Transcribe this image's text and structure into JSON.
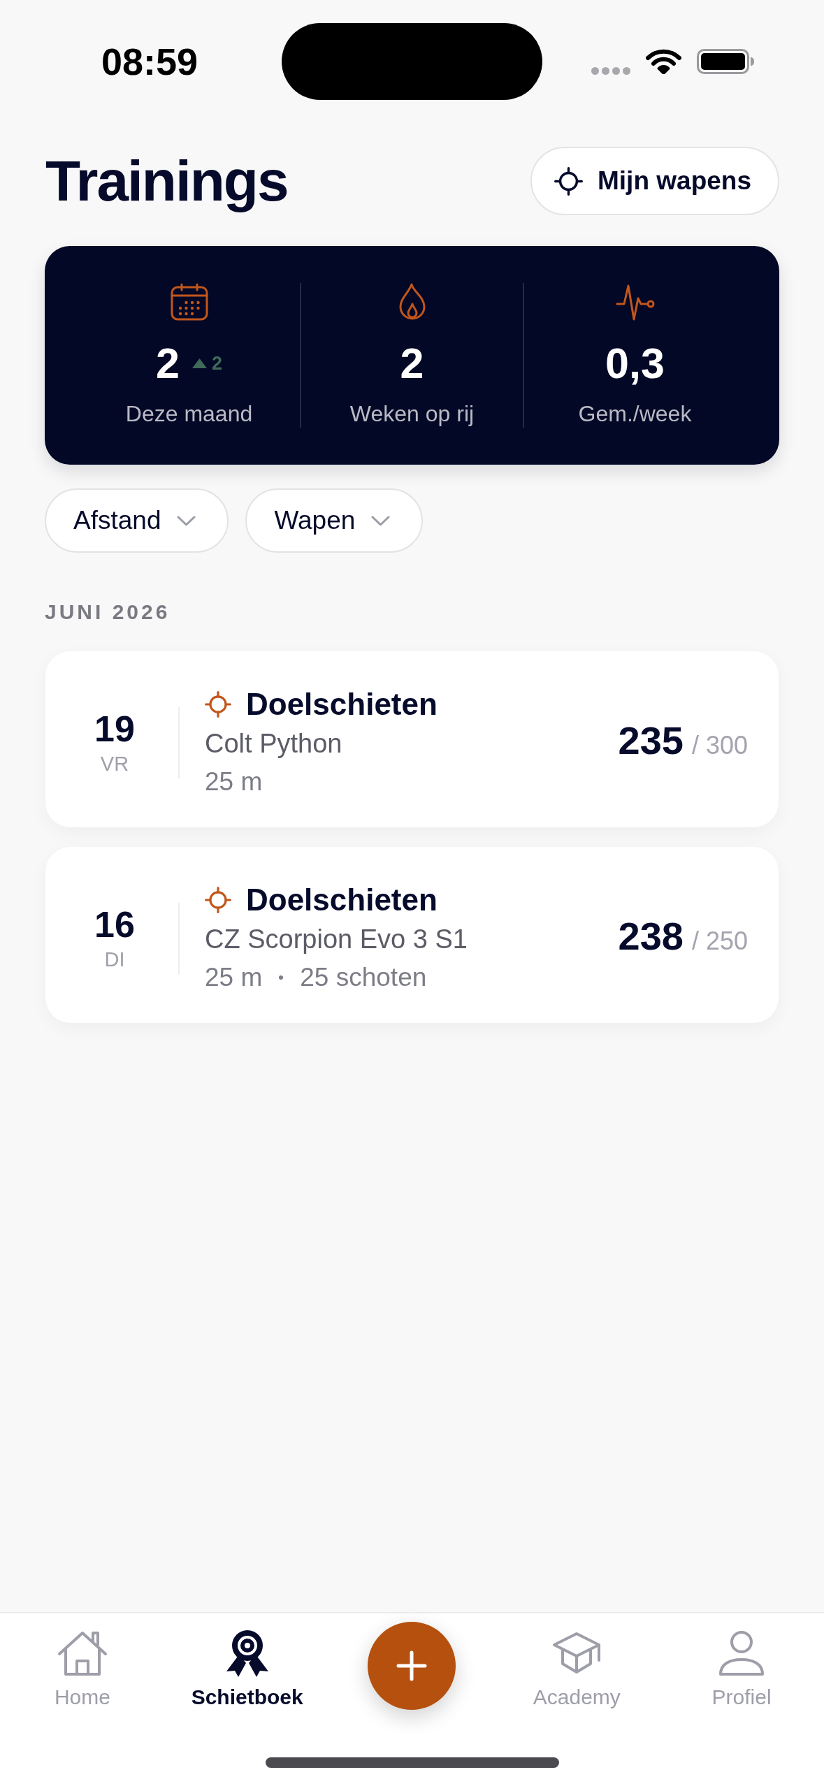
{
  "status_bar": {
    "time": "08:59"
  },
  "header": {
    "title": "Trainings",
    "weapons_button": "Mijn wapens"
  },
  "stats": [
    {
      "kind": "month",
      "value": "2",
      "trend": {
        "up": true,
        "value": "2"
      },
      "label": "Deze maand"
    },
    {
      "kind": "streak",
      "value": "2",
      "label": "Weken op rij"
    },
    {
      "kind": "average",
      "value": "0,3",
      "label": "Gem./week"
    }
  ],
  "filters": [
    {
      "label": "Afstand"
    },
    {
      "label": "Wapen"
    }
  ],
  "sections": [
    {
      "heading": "JUNI 2026",
      "sessions": [
        {
          "day": "19",
          "weekday": "VR",
          "title": "Doelschieten",
          "weapon": "Colt Python",
          "details": [
            "25 m"
          ],
          "score": "235",
          "max": "/ 300"
        },
        {
          "day": "16",
          "weekday": "DI",
          "title": "Doelschieten",
          "weapon": "CZ Scorpion Evo 3 S1",
          "details": [
            "25 m",
            "25 schoten"
          ],
          "score": "238",
          "max": "/ 250"
        }
      ]
    }
  ],
  "tab_bar": {
    "items": [
      {
        "kind": "home",
        "label": "Home",
        "selected": false
      },
      {
        "kind": "logbook",
        "label": "Schietboek",
        "selected": true
      },
      {
        "kind": "add"
      },
      {
        "kind": "academy",
        "label": "Academy",
        "selected": false
      },
      {
        "kind": "profile",
        "label": "Profiel",
        "selected": false
      }
    ]
  }
}
